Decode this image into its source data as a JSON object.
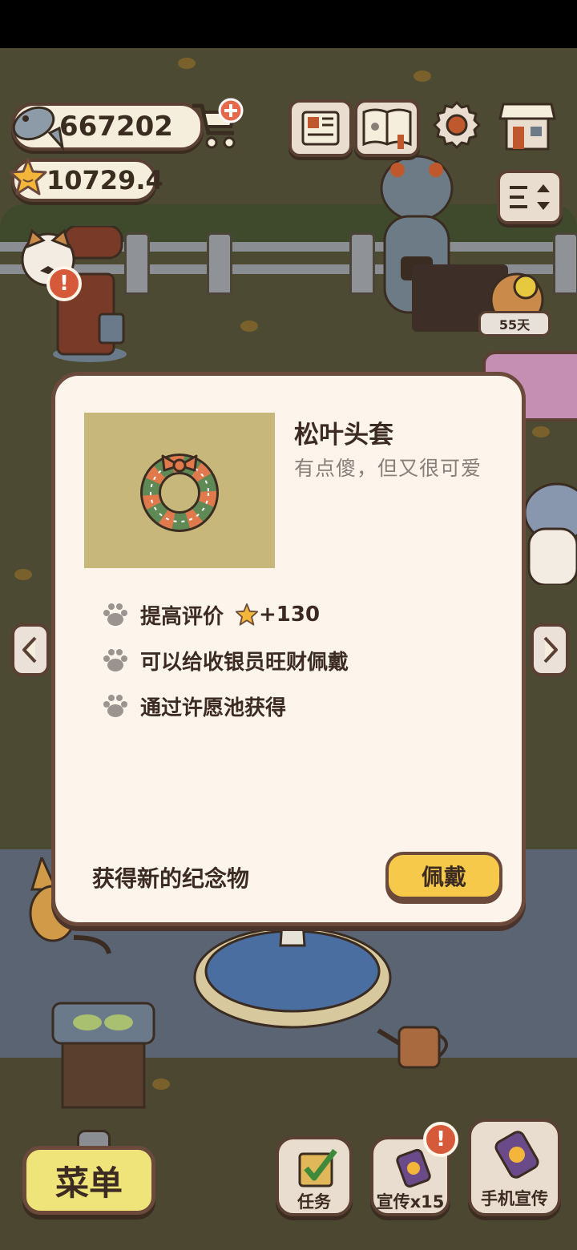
{
  "currency": {
    "fish_amount": "667202",
    "star_amount": "10729.4"
  },
  "top_icons": [
    "newspaper-icon",
    "catalog-book-icon",
    "settings-gear-icon",
    "shop-icon",
    "layout-toggle-icon"
  ],
  "scene": {
    "days_badge": "55天"
  },
  "dialog": {
    "item_name": "松叶头套",
    "item_desc": "有点傻，但又很可爱",
    "attributes": [
      {
        "text": "提高评价",
        "bonus": "+130"
      },
      {
        "text": "可以给收银员旺财佩戴"
      },
      {
        "text": "通过许愿池获得"
      }
    ],
    "footer_text": "获得新的纪念物",
    "wear_label": "佩戴"
  },
  "bottom_bar": {
    "menu_label": "菜单",
    "tasks_label": "任务",
    "promo_label": "宣传x15",
    "phone_promo_label": "手机宣传",
    "alert_mark": "!"
  },
  "colors": {
    "dialog_bg": "#fdf5ec",
    "button_yellow": "#f7c94a",
    "outline_brown": "#6b4a3c",
    "item_bg": "#c7b77a"
  }
}
